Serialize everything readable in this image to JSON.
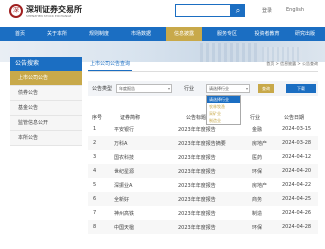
{
  "header": {
    "logo_mark": "深",
    "logo_name": "深圳证券交易所",
    "logo_sub": "SHENZHEN STOCK EXCHANGE",
    "search_icon": "search-icon",
    "util_links": [
      "登录",
      "English"
    ]
  },
  "nav": {
    "items": [
      "首页",
      "关于本所",
      "规则制度",
      "市场数据",
      "信息披露",
      "服务专区",
      "投资者教育",
      "研究出版"
    ],
    "active_index": 4
  },
  "sidebar": {
    "title": "公告搜索",
    "items": [
      "上市公司公告",
      "债券公告",
      "基金公告",
      "监管信息公开",
      "本所公告"
    ],
    "active_index": 0
  },
  "main": {
    "tab_title": "上市公司公告查询",
    "breadcrumb": "首页 > 信息披露 > 公告查询",
    "filter": {
      "label1": "公告类型",
      "select1": "年度报告",
      "label2": "行业",
      "select2": "请选择行业",
      "query_label": "查询",
      "export_label": "下载"
    },
    "dropdown": {
      "options": [
        "请选择行业",
        "农林牧渔",
        "采矿业",
        "制造业"
      ],
      "selected_index": 0
    },
    "table": {
      "headers": [
        "序号",
        "证券简称",
        "公告标题",
        "行业",
        "公告日期"
      ],
      "rows": [
        {
          "seq": "1",
          "name": "平安银行",
          "title": "2023年年度报告",
          "industry": "金融",
          "date": "2024-03-15"
        },
        {
          "seq": "2",
          "name": "万科A",
          "title": "2023年年度报告摘要",
          "industry": "房地产",
          "date": "2024-03-28"
        },
        {
          "seq": "3",
          "name": "国农科技",
          "title": "2023年年度报告",
          "industry": "医药",
          "date": "2024-04-12"
        },
        {
          "seq": "4",
          "name": "世纪星源",
          "title": "2023年年度报告",
          "industry": "环保",
          "date": "2024-04-20"
        },
        {
          "seq": "5",
          "name": "深振业A",
          "title": "2023年年度报告",
          "industry": "房地产",
          "date": "2024-04-22"
        },
        {
          "seq": "6",
          "name": "全新好",
          "title": "2023年年度报告",
          "industry": "商务",
          "date": "2024-04-25"
        },
        {
          "seq": "7",
          "name": "神州高铁",
          "title": "2023年年度报告",
          "industry": "制造",
          "date": "2024-04-26"
        },
        {
          "seq": "8",
          "name": "中国天楹",
          "title": "2023年年度报告",
          "industry": "环保",
          "date": "2024-04-28"
        }
      ]
    }
  },
  "colors": {
    "primary": "#1b6ec2",
    "accent": "#c8a94a"
  }
}
